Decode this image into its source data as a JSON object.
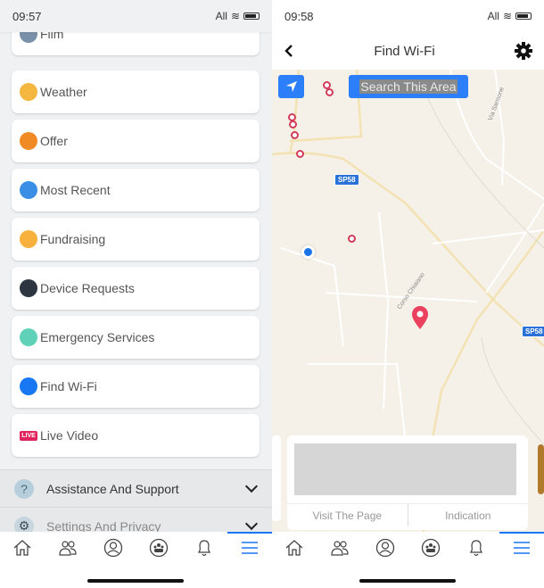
{
  "left_screen": {
    "status": {
      "time": "09:57",
      "carrier": "All"
    },
    "menu_items": [
      {
        "label": "Film",
        "icon": "film-reel-icon",
        "color": "#7a8fa8"
      },
      {
        "label": "Weather",
        "icon": "weather-icon",
        "color": "#f4b740"
      },
      {
        "label": "Offer",
        "icon": "offer-tag-icon",
        "color": "#f08a24"
      },
      {
        "label": "Most Recent",
        "icon": "most-recent-icon",
        "color": "#3a8ee6"
      },
      {
        "label": "Fundraising",
        "icon": "heart-icon",
        "color": "#f7b13c"
      },
      {
        "label": "Device Requests",
        "icon": "device-icon",
        "color": "#2d3540"
      },
      {
        "label": "Emergency Services",
        "icon": "emergency-icon",
        "color": "#5fd1b8"
      },
      {
        "label": "Find Wi-Fi",
        "icon": "wifi-icon",
        "color": "#1877f2"
      },
      {
        "label": "Live Video",
        "icon": "live-icon",
        "color": "#e0245e",
        "badge": "LIVE"
      }
    ],
    "sections": [
      {
        "label": "Assistance And Support",
        "icon": "help-icon",
        "glyph": "?"
      },
      {
        "label": "Settings And Privacy",
        "icon": "gear-icon",
        "glyph": "⚙"
      }
    ]
  },
  "right_screen": {
    "status": {
      "time": "09:58",
      "carrier": "All"
    },
    "header": {
      "title": "Find Wi-Fi"
    },
    "map": {
      "search_button": "Search This Area",
      "road_tags": [
        "SP58",
        "SP58"
      ],
      "street_labels": [
        "Via Sansone",
        "Corso Chiaiano"
      ]
    },
    "info_card": {
      "visit_label": "Visit The Page",
      "indication_label": "Indication"
    }
  },
  "tabbar": [
    "home",
    "friends",
    "profile",
    "groups",
    "notifications",
    "menu"
  ],
  "colors": {
    "accent": "#1877f2",
    "poi": "#d23b5a",
    "map_bg": "#f6f1e8"
  }
}
